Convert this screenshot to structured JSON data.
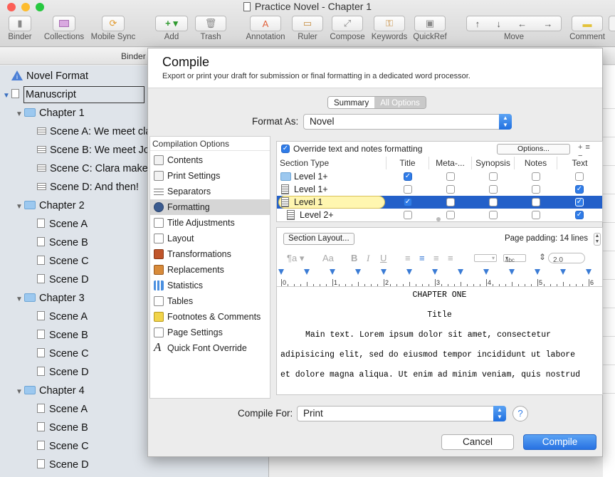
{
  "window": {
    "title": "Practice Novel - Chapter 1"
  },
  "toolbar": {
    "binder": "Binder",
    "collections": "Collections",
    "mobile_sync": "Mobile Sync",
    "add": "Add",
    "trash": "Trash",
    "annotation": "Annotation",
    "ruler": "Ruler",
    "compose": "Compose",
    "keywords": "Keywords",
    "quickref": "QuickRef",
    "move": "Move",
    "comment": "Comment"
  },
  "binder": {
    "header": "Binder",
    "items": [
      {
        "label": "Novel Format"
      },
      {
        "label": "Manuscript"
      },
      {
        "label": "Chapter 1"
      },
      {
        "label": "Scene A: We meet cla"
      },
      {
        "label": "Scene B: We meet Joe"
      },
      {
        "label": "Scene C: Clara make"
      },
      {
        "label": "Scene D: And then!"
      },
      {
        "label": "Chapter 2"
      },
      {
        "label": "Scene A"
      },
      {
        "label": "Scene B"
      },
      {
        "label": "Scene C"
      },
      {
        "label": "Scene D"
      },
      {
        "label": "Chapter 3"
      },
      {
        "label": "Scene A"
      },
      {
        "label": "Scene B"
      },
      {
        "label": "Scene C"
      },
      {
        "label": "Scene D"
      },
      {
        "label": "Chapter 4"
      },
      {
        "label": "Scene A"
      },
      {
        "label": "Scene B"
      },
      {
        "label": "Scene C"
      },
      {
        "label": "Scene D"
      }
    ]
  },
  "compile": {
    "title": "Compile",
    "subtitle": "Export or print your draft for submission or final formatting in a dedicated word processor.",
    "tabs": {
      "summary": "Summary",
      "all_options": "All Options"
    },
    "format_as_label": "Format As:",
    "format_as_value": "Novel",
    "options_header": "Compilation Options",
    "options": [
      {
        "label": "Contents"
      },
      {
        "label": "Print Settings"
      },
      {
        "label": "Separators"
      },
      {
        "label": "Formatting"
      },
      {
        "label": "Title Adjustments"
      },
      {
        "label": "Layout"
      },
      {
        "label": "Transformations"
      },
      {
        "label": "Replacements"
      },
      {
        "label": "Statistics"
      },
      {
        "label": "Tables"
      },
      {
        "label": "Footnotes & Comments"
      },
      {
        "label": "Page Settings"
      },
      {
        "label": "Quick Font Override"
      }
    ],
    "override_label": "Override text and notes formatting",
    "options_button": "Options...",
    "plus_minus": "+≡ −",
    "columns": [
      "Section Type",
      "Title",
      "Meta-...",
      "Synopsis",
      "Notes",
      "Text"
    ],
    "rows": [
      {
        "name": "Level  1+",
        "title": true,
        "meta": false,
        "synopsis": false,
        "notes": false,
        "text": false
      },
      {
        "name": "Level  1+",
        "title": false,
        "meta": false,
        "synopsis": false,
        "notes": false,
        "text": true
      },
      {
        "name": "Level  1",
        "title": true,
        "meta": false,
        "synopsis": false,
        "notes": false,
        "text": true
      },
      {
        "name": "Level  2+",
        "title": false,
        "meta": false,
        "synopsis": false,
        "notes": false,
        "text": true
      }
    ],
    "section_layout_button": "Section Layout...",
    "page_padding": "Page padding: 14 lines",
    "line_spacing": "2.0",
    "font_style": "abc",
    "ruler_numbers": [
      "0",
      "1",
      "2",
      "3",
      "4",
      "5",
      "6"
    ],
    "preview": {
      "heading": "CHAPTER ONE",
      "title": "Title",
      "line1": "Main text. Lorem ipsum dolor sit amet, consectetur",
      "line2": "adipisicing elit, sed do eiusmod tempor incididunt ut labore",
      "line3": "et dolore magna aliqua. Ut enim ad minim veniam, quis nostrud"
    },
    "compile_for_label": "Compile For:",
    "compile_for_value": "Print",
    "cancel": "Cancel",
    "compile_button": "Compile"
  }
}
